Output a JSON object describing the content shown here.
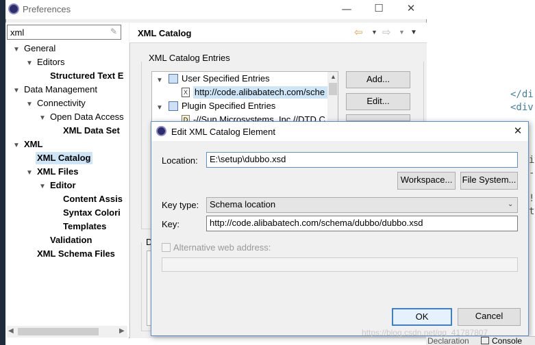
{
  "editor_bg": {
    "lines": [
      "</di",
      "<div",
      "i",
      "-",
      "!",
      "t"
    ]
  },
  "window": {
    "title": "Preferences",
    "minimize_glyph": "—",
    "maximize_glyph": "☐",
    "close_glyph": "✕"
  },
  "filter": {
    "value": "xml"
  },
  "tree": [
    {
      "label": "General"
    },
    {
      "label": "Editors"
    },
    {
      "label": "Structured Text E"
    },
    {
      "label": "Data Management"
    },
    {
      "label": "Connectivity"
    },
    {
      "label": "Open Data Access"
    },
    {
      "label": "XML Data Set"
    },
    {
      "label": "XML"
    },
    {
      "label": "XML Catalog"
    },
    {
      "label": "XML Files"
    },
    {
      "label": "Editor"
    },
    {
      "label": "Content Assis"
    },
    {
      "label": "Syntax Colori"
    },
    {
      "label": "Templates"
    },
    {
      "label": "Validation"
    },
    {
      "label": "XML Schema Files"
    }
  ],
  "page": {
    "title": "XML Catalog",
    "entries_group": "XML Catalog Entries",
    "entries": [
      {
        "label": "User Specified Entries"
      },
      {
        "label": "http://code.alibabatech.com/sche"
      },
      {
        "label": "Plugin Specified Entries"
      },
      {
        "label": "-//Sun Microsystems, Inc.//DTD C"
      }
    ],
    "add_button": "Add...",
    "edit_button": "Edit...",
    "details_group": "D"
  },
  "dialog": {
    "title": "Edit XML Catalog Element",
    "location_label": "Location:",
    "location_value": "E:\\setup\\dubbo.xsd",
    "workspace_button": "Workspace...",
    "filesystem_button": "File System...",
    "key_type_label": "Key type:",
    "key_type_value": "Schema location",
    "key_label": "Key:",
    "key_value": "http://code.alibabatech.com/schema/dubbo/dubbo.xsd",
    "alt_label": "Alternative web address:",
    "alt_value": "",
    "ok_button": "OK",
    "cancel_button": "Cancel"
  },
  "bottom_tabs": {
    "declaration": "Declaration",
    "console": "Console"
  },
  "watermark": "https://blog.csdn.net/qq_41787807",
  "colors": {
    "accent": "#5b8fc7",
    "selection": "#cde6f7"
  }
}
